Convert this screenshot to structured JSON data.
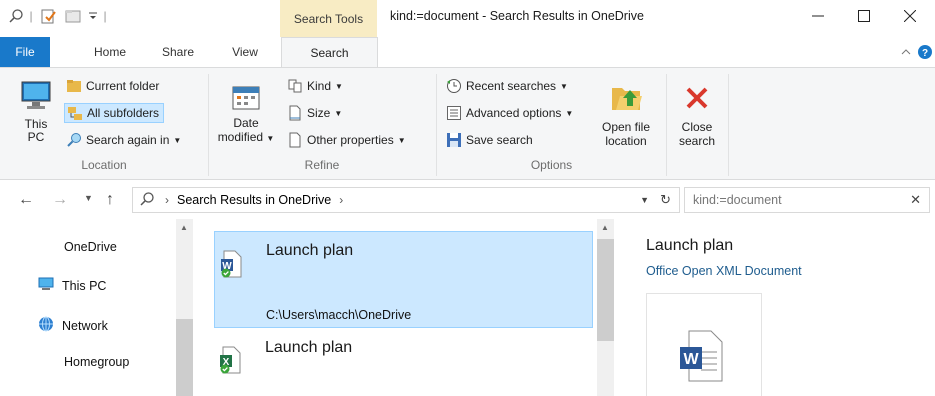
{
  "window": {
    "title": "kind:=document - Search Results in OneDrive",
    "context_tab": "Search Tools",
    "minimize": "—",
    "maximize": "☐",
    "close": "✕"
  },
  "tabs": [
    "File",
    "Home",
    "Share",
    "View",
    "Search"
  ],
  "ribbon": {
    "location": {
      "label": "Location",
      "this_pc": "This\nPC",
      "current_folder": "Current folder",
      "all_subfolders": "All subfolders",
      "search_again": "Search again in"
    },
    "refine": {
      "label": "Refine",
      "date_modified_1": "Date",
      "date_modified_2": "modified",
      "kind": "Kind",
      "size": "Size",
      "other_properties": "Other properties"
    },
    "options": {
      "label": "Options",
      "recent_searches": "Recent searches",
      "advanced_options": "Advanced options",
      "save_search": "Save search",
      "open_file_location_1": "Open file",
      "open_file_location_2": "location"
    },
    "close_search_1": "Close",
    "close_search_2": "search"
  },
  "address": {
    "path": "Search Results in OneDrive",
    "search_value": "kind:=document"
  },
  "nav": {
    "items": [
      "OneDrive",
      "This PC",
      "Network",
      "Homegroup"
    ]
  },
  "files": [
    {
      "name": "Launch plan",
      "path": "C:\\Users\\macch\\OneDrive",
      "type": "word"
    },
    {
      "name": "Launch plan",
      "path": "",
      "type": "excel"
    }
  ],
  "preview": {
    "title": "Launch plan",
    "type": "Office Open XML Document"
  },
  "colors": {
    "file_tab": "#1979ca",
    "context_tab": "#f8ecc4",
    "selection": "#cce8ff",
    "close_search": "#d9382c"
  }
}
